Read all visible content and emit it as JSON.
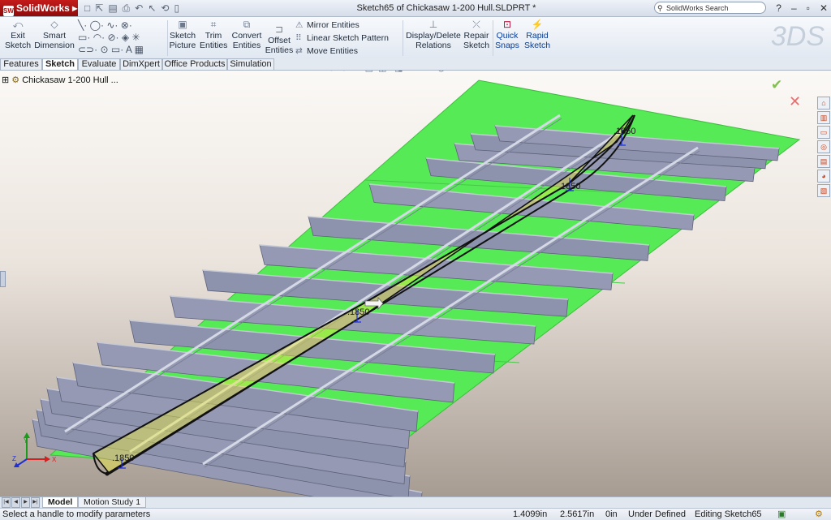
{
  "app": {
    "name": "SolidWorks",
    "logo_mark": "SW",
    "window_title": "Sketch65 of Chickasaw 1-200 Hull.SLDPRT *",
    "search_placeholder": "SolidWorks Search",
    "help_label": "?"
  },
  "ribbon": {
    "exit_sketch": "Exit Sketch",
    "smart_dimension": "Smart Dimension",
    "sketch_picture": "Sketch Picture",
    "trim_entities": "Trim Entities",
    "convert_entities": "Convert Entities",
    "offset_entities": "Offset Entities",
    "mirror_entities": "Mirror Entities",
    "linear_sketch_pattern": "Linear Sketch Pattern",
    "move_entities": "Move Entities",
    "display_delete_relations": "Display/Delete Relations",
    "repair_sketch": "Repair Sketch",
    "quick_snaps": "Quick Snaps",
    "rapid_sketch": "Rapid Sketch"
  },
  "tabs": [
    {
      "label": "Features"
    },
    {
      "label": "Sketch"
    },
    {
      "label": "Evaluate"
    },
    {
      "label": "DimXpert"
    },
    {
      "label": "Office Products"
    },
    {
      "label": "Simulation"
    }
  ],
  "tree": {
    "root": "Chickasaw 1-200 Hull ..."
  },
  "dims": {
    "d1": ".1850",
    "d2": ".1850",
    "d3": ".1850",
    "d4": ".1850"
  },
  "triad": {
    "x": "X",
    "y": "Y",
    "z": "Z"
  },
  "bottom_tabs": [
    {
      "label": "Model"
    },
    {
      "label": "Motion Study 1"
    }
  ],
  "status": {
    "message": "Select a handle to modify parameters",
    "x": "1.4099in",
    "y": "2.5617in",
    "z": "0in",
    "state": "Under Defined",
    "editing": "Editing Sketch65"
  },
  "colors": {
    "deck_green": "#57ea57",
    "frame_gray": "#8d92ad",
    "frame_gray_dark": "#6c7088",
    "sketch_yellow": "#ecec3e",
    "accent_red": "#b8002e"
  }
}
